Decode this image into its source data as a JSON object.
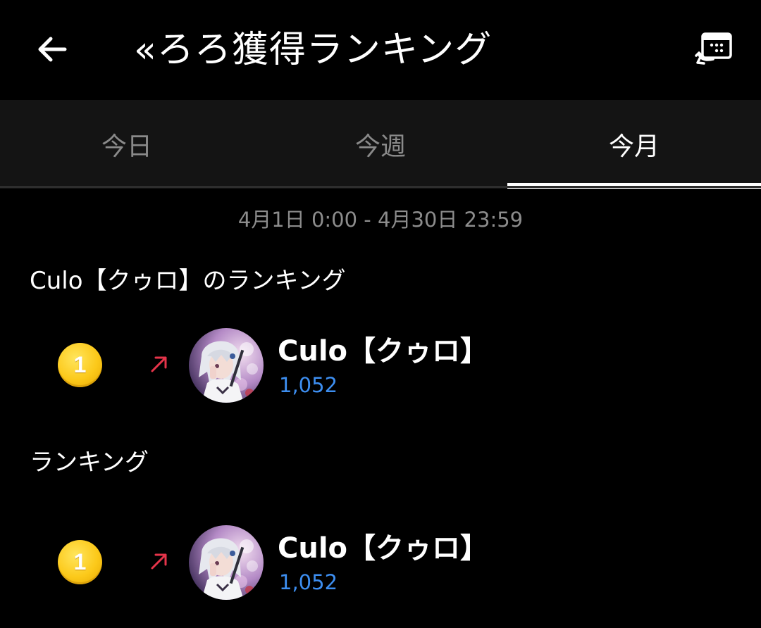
{
  "header": {
    "title": "«ろろ獲得ランキング",
    "back_icon": "arrow-left-icon",
    "history_icon": "history-list-icon"
  },
  "tabs": [
    {
      "label": "今日",
      "active": false
    },
    {
      "label": "今週",
      "active": false
    },
    {
      "label": "今月",
      "active": true
    }
  ],
  "period": "4月1日 0:00 - 4月30日 23:59",
  "my_ranking": {
    "title": "Culo【クゥロ】のランキング",
    "entry": {
      "rank": "1",
      "trend": "up",
      "name": "Culo【クゥロ】",
      "score": "1,052"
    }
  },
  "ranking": {
    "title": "ランキング",
    "entries": [
      {
        "rank": "1",
        "trend": "up",
        "name": "Culo【クゥロ】",
        "score": "1,052"
      }
    ]
  },
  "colors": {
    "background": "#000000",
    "tab_bar": "#141414",
    "score": "#3d8ef0",
    "trend_up": "#e5344a",
    "medal": "#fcc91a"
  }
}
